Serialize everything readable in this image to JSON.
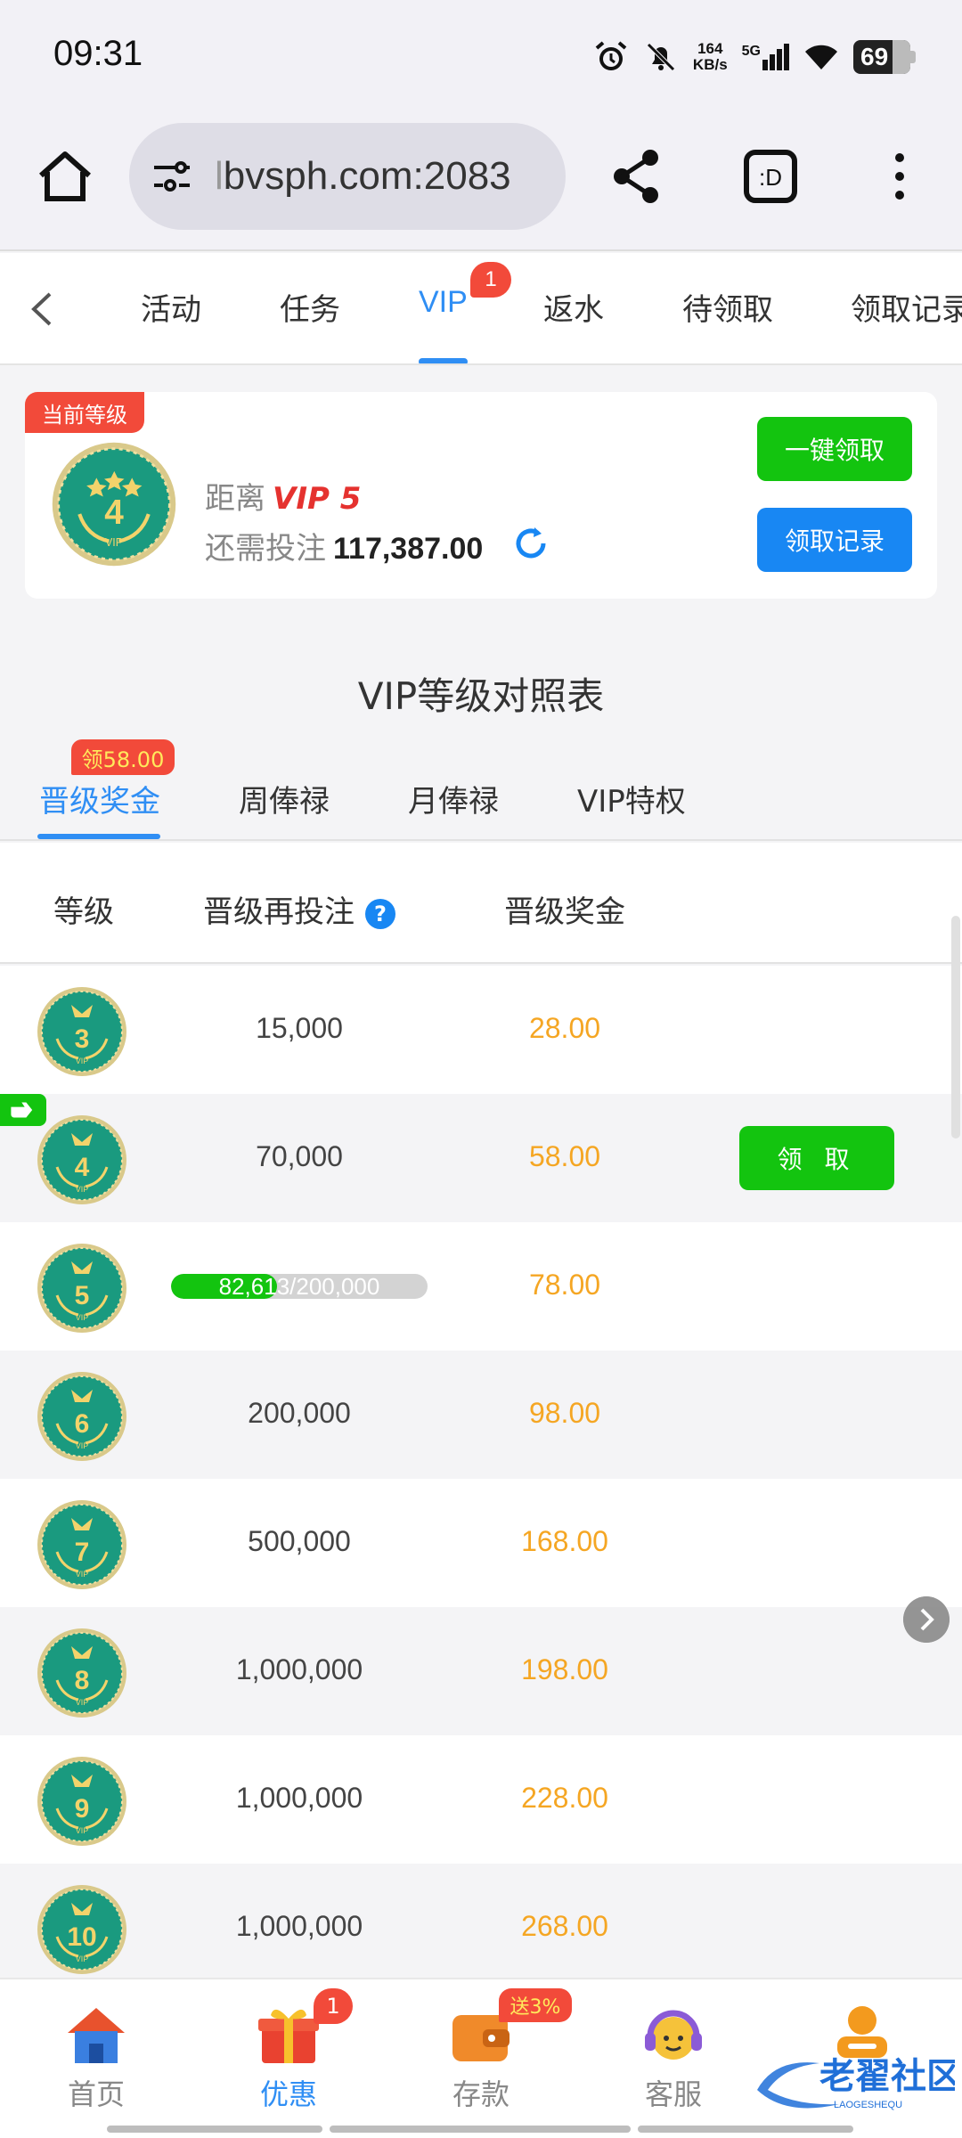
{
  "status": {
    "time": "09:31",
    "speed_value": "164",
    "speed_unit": "KB/s",
    "network": "5G",
    "battery": "69"
  },
  "browser": {
    "url_prefix": "l",
    "url": "bvsph.com:2083"
  },
  "nav": {
    "tabs": [
      {
        "label": "活动"
      },
      {
        "label": "任务"
      },
      {
        "label": "VIP"
      },
      {
        "label": "返水"
      },
      {
        "label": "待领取"
      },
      {
        "label": "领取记录"
      }
    ],
    "active_index": 2,
    "vip_badge": "1"
  },
  "current": {
    "tag": "当前等级",
    "level": "4",
    "distance_label": "距离",
    "next_vip": "VIP 5",
    "need_label": "还需投注",
    "need_amount": "117,387.00",
    "claim_all": "一键领取",
    "records": "领取记录"
  },
  "section_title": "VIP等级对照表",
  "subtabs": {
    "items": [
      {
        "label": "晋级奖金"
      },
      {
        "label": "周俸禄"
      },
      {
        "label": "月俸禄"
      },
      {
        "label": "VIP特权"
      }
    ],
    "bonus_badge": "领58.00"
  },
  "table": {
    "headers": {
      "level": "等级",
      "bet": "晋级再投注",
      "bonus": "晋级奖金"
    },
    "claim_label": "领 取",
    "rows": [
      {
        "level": "3",
        "bet": "15,000",
        "bonus": "28.00"
      },
      {
        "level": "4",
        "bet": "70,000",
        "bonus": "58.00",
        "current": true
      },
      {
        "level": "5",
        "progress_text": "82,613/200,000",
        "progress": 0.413,
        "bonus": "78.00"
      },
      {
        "level": "6",
        "bet": "200,000",
        "bonus": "98.00"
      },
      {
        "level": "7",
        "bet": "500,000",
        "bonus": "168.00"
      },
      {
        "level": "8",
        "bet": "1,000,000",
        "bonus": "198.00"
      },
      {
        "level": "9",
        "bet": "1,000,000",
        "bonus": "228.00"
      },
      {
        "level": "10",
        "bet": "1,000,000",
        "bonus": "268.00"
      }
    ]
  },
  "bottom_nav": {
    "items": [
      {
        "label": "首页"
      },
      {
        "label": "优惠"
      },
      {
        "label": "存款"
      },
      {
        "label": "客服"
      }
    ],
    "promo_badge": "1",
    "deposit_badge": "送3%",
    "watermark_text": "老翟社区",
    "watermark_sub": "LAOGESHEQU"
  },
  "colors": {
    "accent": "#2f8ef4",
    "green": "#13c40f",
    "red": "#f24a3a",
    "gold": "#f5a623",
    "medal": "#1a9a7f"
  }
}
